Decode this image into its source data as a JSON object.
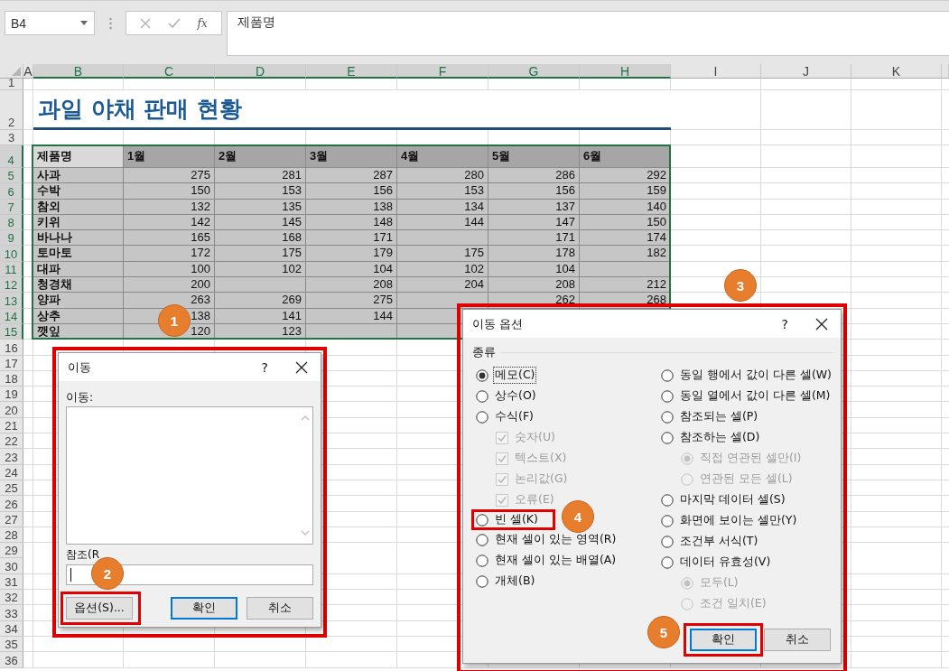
{
  "name_box": {
    "value": "B4"
  },
  "formula_bar": {
    "function_label": "fx",
    "value": "제품명"
  },
  "columns": [
    {
      "label": "A",
      "selected": false
    },
    {
      "label": "B",
      "selected": true
    },
    {
      "label": "C",
      "selected": true
    },
    {
      "label": "D",
      "selected": true
    },
    {
      "label": "E",
      "selected": true
    },
    {
      "label": "F",
      "selected": true
    },
    {
      "label": "G",
      "selected": true
    },
    {
      "label": "H",
      "selected": true
    },
    {
      "label": "I",
      "selected": false
    },
    {
      "label": "J",
      "selected": false
    },
    {
      "label": "K",
      "selected": false
    }
  ],
  "rows": [
    {
      "label": "1",
      "selected": false
    },
    {
      "label": "2",
      "selected": false
    },
    {
      "label": "3",
      "selected": false
    },
    {
      "label": "4",
      "selected": true
    },
    {
      "label": "5",
      "selected": true
    },
    {
      "label": "6",
      "selected": true
    },
    {
      "label": "7",
      "selected": true
    },
    {
      "label": "8",
      "selected": true
    },
    {
      "label": "9",
      "selected": true
    },
    {
      "label": "10",
      "selected": true
    },
    {
      "label": "11",
      "selected": true
    },
    {
      "label": "12",
      "selected": true
    },
    {
      "label": "13",
      "selected": true
    },
    {
      "label": "14",
      "selected": true
    },
    {
      "label": "15",
      "selected": true
    },
    {
      "label": "16",
      "selected": false
    },
    {
      "label": "17",
      "selected": false
    },
    {
      "label": "18",
      "selected": false
    },
    {
      "label": "19",
      "selected": false
    },
    {
      "label": "20",
      "selected": false
    },
    {
      "label": "21",
      "selected": false
    },
    {
      "label": "22",
      "selected": false
    },
    {
      "label": "23",
      "selected": false
    },
    {
      "label": "24",
      "selected": false
    },
    {
      "label": "25",
      "selected": false
    },
    {
      "label": "26",
      "selected": false
    },
    {
      "label": "27",
      "selected": false
    },
    {
      "label": "28",
      "selected": false
    },
    {
      "label": "29",
      "selected": false
    },
    {
      "label": "30",
      "selected": false
    },
    {
      "label": "31",
      "selected": false
    },
    {
      "label": "32",
      "selected": false
    },
    {
      "label": "33",
      "selected": false
    },
    {
      "label": "34",
      "selected": false
    },
    {
      "label": "35",
      "selected": false
    },
    {
      "label": "36",
      "selected": false
    }
  ],
  "sheet": {
    "title": "과일 야채 판매 현황",
    "table": {
      "columns": [
        {
          "label": "제품명",
          "active": true
        },
        {
          "label": "1월",
          "active": false
        },
        {
          "label": "2월",
          "active": false
        },
        {
          "label": "3월",
          "active": false
        },
        {
          "label": "4월",
          "active": false
        },
        {
          "label": "5월",
          "active": false
        },
        {
          "label": "6월",
          "active": false
        }
      ],
      "rows": [
        [
          "사과",
          "275",
          "281",
          "287",
          "280",
          "286",
          "292"
        ],
        [
          "수박",
          "150",
          "153",
          "156",
          "153",
          "156",
          "159"
        ],
        [
          "참외",
          "132",
          "135",
          "138",
          "134",
          "137",
          "140"
        ],
        [
          "키위",
          "142",
          "145",
          "148",
          "144",
          "147",
          "150"
        ],
        [
          "바나나",
          "165",
          "168",
          "171",
          null,
          "171",
          "174"
        ],
        [
          "토마토",
          "172",
          "175",
          "179",
          "175",
          "178",
          "182"
        ],
        [
          "대파",
          "100",
          "102",
          "104",
          "102",
          "104",
          null
        ],
        [
          "청경채",
          "200",
          null,
          "208",
          "204",
          "208",
          "212"
        ],
        [
          "양파",
          "263",
          "269",
          "275",
          null,
          "262",
          "268"
        ],
        [
          "상추",
          "138",
          "141",
          "144",
          null
        ],
        [
          "깻잎",
          "120",
          "123",
          null,
          null
        ]
      ]
    }
  },
  "dialogs": [
    {
      "kind": "goto",
      "title": "이동",
      "help": "?",
      "highlighted": true,
      "list_label": "이동:",
      "reference_label": "참조(R",
      "reference_focused": true,
      "buttons": [
        {
          "label": "옵션(S)...",
          "default": false,
          "highlighted": true
        },
        {
          "label": "확인",
          "default": true,
          "highlighted": false
        },
        {
          "label": "취소",
          "default": false,
          "highlighted": false
        }
      ]
    },
    {
      "kind": "options",
      "title": "이동 옵션",
      "help": "?",
      "highlighted": true,
      "group_label": "종류",
      "columns": [
        [
          {
            "kind": "radio",
            "label": "메모(C)",
            "selected": true,
            "disabled": false,
            "focused": true,
            "highlighted": false
          },
          {
            "kind": "radio",
            "label": "상수(O)",
            "selected": false,
            "disabled": false,
            "focused": false,
            "highlighted": false
          },
          {
            "kind": "radio",
            "label": "수식(F)",
            "selected": false,
            "disabled": false,
            "focused": false,
            "highlighted": false,
            "children": [
              {
                "kind": "check",
                "label": "숫자(U)",
                "checked": true,
                "disabled": true,
                "focused": false,
                "highlighted": false
              },
              {
                "kind": "check",
                "label": "텍스트(X)",
                "checked": true,
                "disabled": true,
                "focused": false,
                "highlighted": false
              },
              {
                "kind": "check",
                "label": "논리값(G)",
                "checked": true,
                "disabled": true,
                "focused": false,
                "highlighted": false
              },
              {
                "kind": "check",
                "label": "오류(E)",
                "checked": true,
                "disabled": true,
                "focused": false,
                "highlighted": false
              }
            ]
          },
          {
            "kind": "radio",
            "label": "빈 셀(K)",
            "selected": false,
            "disabled": false,
            "focused": false,
            "highlighted": true
          },
          {
            "kind": "radio",
            "label": "현재 셀이 있는 영역(R)",
            "selected": false,
            "disabled": false,
            "focused": false,
            "highlighted": false
          },
          {
            "kind": "radio",
            "label": "현재 셀이 있는 배열(A)",
            "selected": false,
            "disabled": false,
            "focused": false,
            "highlighted": false
          },
          {
            "kind": "radio",
            "label": "개체(B)",
            "selected": false,
            "disabled": false,
            "focused": false,
            "highlighted": false
          }
        ],
        [
          {
            "kind": "radio",
            "label": "동일 행에서 값이 다른 셀(W)",
            "selected": false,
            "disabled": false,
            "focused": false,
            "highlighted": false
          },
          {
            "kind": "radio",
            "label": "동일 열에서 값이 다른 셀(M)",
            "selected": false,
            "disabled": false,
            "focused": false,
            "highlighted": false
          },
          {
            "kind": "radio",
            "label": "참조되는 셀(P)",
            "selected": false,
            "disabled": false,
            "focused": false,
            "highlighted": false
          },
          {
            "kind": "radio",
            "label": "참조하는 셀(D)",
            "selected": false,
            "disabled": false,
            "focused": false,
            "highlighted": false,
            "children": [
              {
                "kind": "radio",
                "label": "직접 연관된 셀만(I)",
                "selected": true,
                "disabled": true,
                "focused": false,
                "highlighted": false
              },
              {
                "kind": "radio",
                "label": "연관된 모든 셀(L)",
                "selected": false,
                "disabled": true,
                "focused": false,
                "highlighted": false
              }
            ]
          },
          {
            "kind": "radio",
            "label": "마지막 데이터 셀(S)",
            "selected": false,
            "disabled": false,
            "focused": false,
            "highlighted": false
          },
          {
            "kind": "radio",
            "label": "화면에 보이는 셀만(Y)",
            "selected": false,
            "disabled": false,
            "focused": false,
            "highlighted": false
          },
          {
            "kind": "radio",
            "label": "조건부 서식(T)",
            "selected": false,
            "disabled": false,
            "focused": false,
            "highlighted": false
          },
          {
            "kind": "radio",
            "label": "데이터 유효성(V)",
            "selected": false,
            "disabled": false,
            "focused": false,
            "highlighted": false,
            "children": [
              {
                "kind": "radio",
                "label": "모두(L)",
                "selected": true,
                "disabled": true,
                "focused": false,
                "highlighted": false
              },
              {
                "kind": "radio",
                "label": "조건 일치(E)",
                "selected": false,
                "disabled": true,
                "focused": false,
                "highlighted": false
              }
            ]
          }
        ]
      ],
      "buttons": [
        {
          "label": "확인",
          "default": true,
          "highlighted": true
        },
        {
          "label": "취소",
          "default": false,
          "highlighted": false
        }
      ]
    }
  ],
  "callouts": [
    "1",
    "2",
    "3",
    "4",
    "5"
  ]
}
